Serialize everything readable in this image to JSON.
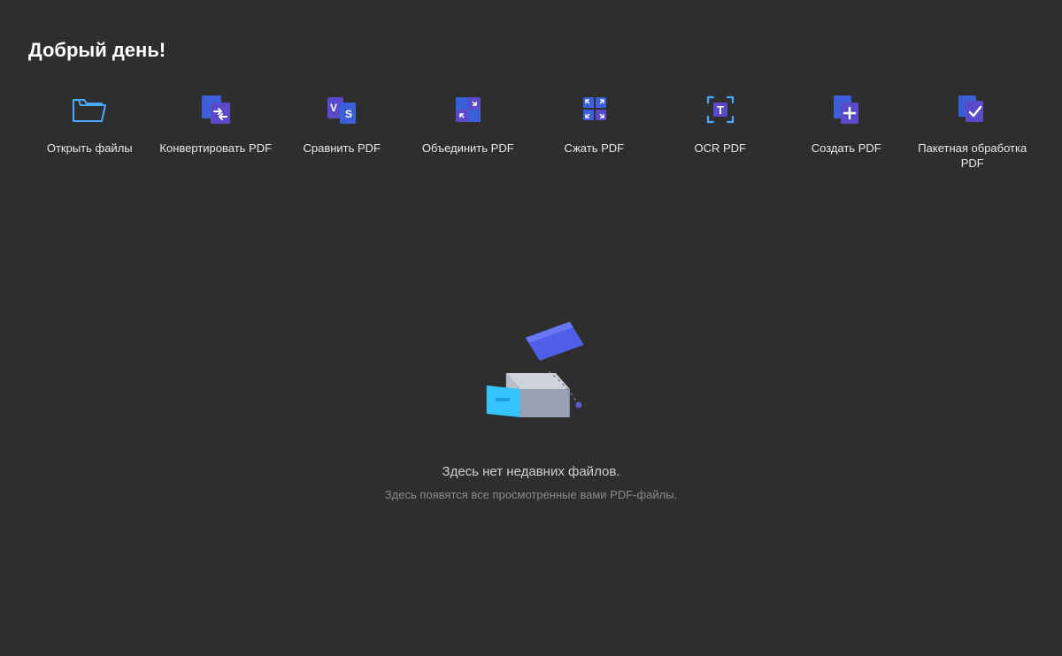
{
  "greeting": "Добрый день!",
  "actions": [
    {
      "label": "Открыть файлы"
    },
    {
      "label": "Конвертировать PDF"
    },
    {
      "label": "Сравнить PDF"
    },
    {
      "label": "Объединить PDF"
    },
    {
      "label": "Сжать PDF"
    },
    {
      "label": "OCR PDF"
    },
    {
      "label": "Создать PDF"
    },
    {
      "label": "Пакетная обработка PDF"
    }
  ],
  "empty": {
    "title": "Здесь нет недавних файлов.",
    "subtitle": "Здесь появятся все просмотренные вами PDF-файлы."
  }
}
